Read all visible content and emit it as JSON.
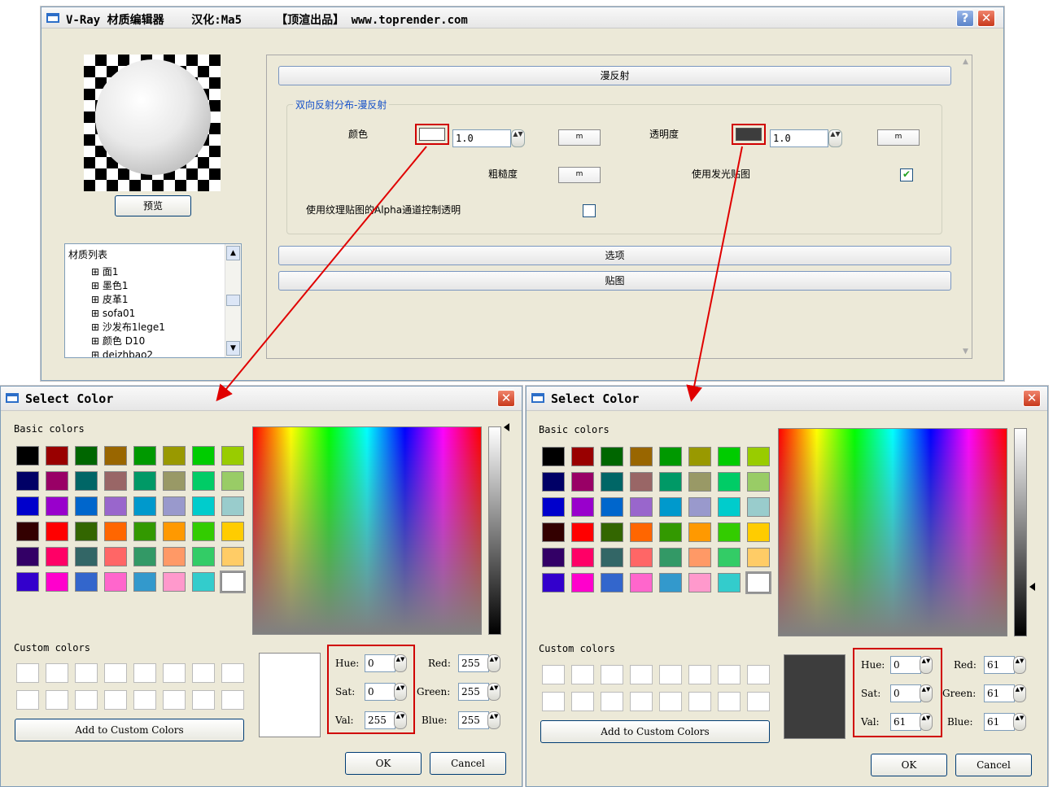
{
  "editor": {
    "title": "V-Ray 材质编辑器    汉化:Ma5     【顶渲出品】 www.toprender.com",
    "help_label": "?",
    "close_label": "✕",
    "preview_button": "预览",
    "material_list": {
      "header": "材质列表",
      "items": [
        "面1",
        "墨色1",
        "皮革1",
        "sofa01",
        "沙发布1lege1",
        "颜色 D10",
        "deizhbao2"
      ]
    },
    "rollouts": {
      "diffuse": "漫反射",
      "options": "选项",
      "maps": "贴图"
    },
    "group_title": "双向反射分布-漫反射",
    "color_label": "颜色",
    "color_value": "1.0",
    "transparency_label": "透明度",
    "transparency_value": "1.0",
    "roughness_label": "粗糙度",
    "glossy_label": "使用发光贴图",
    "alpha_label": "使用纹理贴图的Alpha通道控制透明",
    "map_button": "m",
    "checkmark": "✔",
    "spin_arrows": "▲▼"
  },
  "dialog_common": {
    "title": "Select Color",
    "basic_label": "Basic colors",
    "custom_label": "Custom colors",
    "add_button": "Add to Custom Colors",
    "ok": "OK",
    "cancel": "Cancel",
    "hue_label": "Hue:",
    "sat_label": "Sat:",
    "val_label": "Val:",
    "red_label": "Red:",
    "green_label": "Green:",
    "blue_label": "Blue:",
    "close_label": "✕",
    "basic_colors": [
      "#000000",
      "#990000",
      "#006600",
      "#996600",
      "#009900",
      "#999900",
      "#00cc00",
      "#99cc00",
      "#000066",
      "#990066",
      "#006666",
      "#996666",
      "#009966",
      "#999966",
      "#00cc66",
      "#99cc66",
      "#0000cc",
      "#9900cc",
      "#0066cc",
      "#9966cc",
      "#0099cc",
      "#9999cc",
      "#00cccc",
      "#99cccc",
      "#330000",
      "#ff0000",
      "#336600",
      "#ff6600",
      "#339900",
      "#ff9900",
      "#33cc00",
      "#ffcc00",
      "#330066",
      "#ff0066",
      "#336666",
      "#ff6666",
      "#339966",
      "#ff9966",
      "#33cc66",
      "#ffcc66",
      "#3300cc",
      "#ff00cc",
      "#3366cc",
      "#ff66cc",
      "#3399cc",
      "#ff99cc",
      "#33cccc",
      "#ffffff"
    ]
  },
  "dialog_left": {
    "hue": "0",
    "sat": "0",
    "val": "255",
    "red": "255",
    "green": "255",
    "blue": "255",
    "preview_color": "#ffffff"
  },
  "dialog_right": {
    "hue": "0",
    "sat": "0",
    "val": "61",
    "red": "61",
    "green": "61",
    "blue": "61",
    "preview_color": "#3d3d3d"
  }
}
